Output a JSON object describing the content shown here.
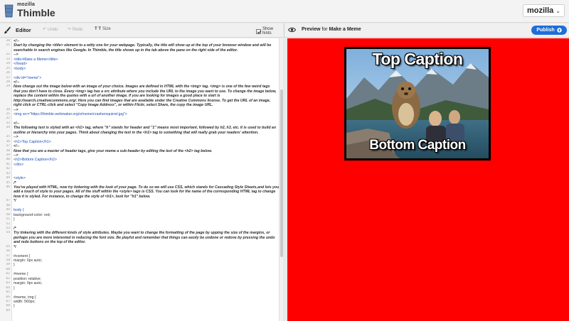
{
  "brand": {
    "mozilla": "mozilla",
    "name": "Thimble"
  },
  "account": {
    "label": "mozilla"
  },
  "editor_toolbar": {
    "title": "Editor",
    "undo": "Undo",
    "redo": "Redo",
    "size_glyph": "T T",
    "size": "Size",
    "hints": "Show hints"
  },
  "preview_toolbar": {
    "prefix": "Preview",
    "for": " for ",
    "page": "Make a Meme",
    "publish": "Publish"
  },
  "code_lines": [
    {
      "n": "20",
      "t": "<!--",
      "k": "comment"
    },
    {
      "n": "21",
      "t": "Start by changing the <title> element to a witty one for your webpage. Typically, the title will show up at the top of your browser window and will be",
      "k": "comment"
    },
    {
      "n": "",
      "t": "searchable in search engines like Google. In Thimble, the title shows up in the tab above the pane on the right side of the editor.",
      "k": "comment"
    },
    {
      "n": "22",
      "t": "-->",
      "k": "comment"
    },
    {
      "n": "23",
      "t": "    <title>Make a Meme</title>",
      "k": "tag"
    },
    {
      "n": "24",
      "t": "  </head>",
      "k": "tag"
    },
    {
      "n": "25",
      "t": "  <body>",
      "k": "tag"
    },
    {
      "n": "26",
      "t": "",
      "k": "tag"
    },
    {
      "n": "27",
      "t": "    <div id=\"meme\">",
      "k": "tag"
    },
    {
      "n": "28",
      "t": "<!--",
      "k": "comment"
    },
    {
      "n": "29",
      "t": "Now change out the image below with an image of your choice. Images are defined in HTML with the <img> tag. <img> is one of the few weird tags",
      "k": "comment"
    },
    {
      "n": "",
      "t": "that you don't have to close. Every <img> tag has a src attribute where you include the URL to the image you want to use. To change the image below,",
      "k": "comment"
    },
    {
      "n": "",
      "t": "replace the content within the quotes with a url of another image. If you are looking for images a good place to start is",
      "k": "comment"
    },
    {
      "n": "",
      "t": "http://search.creativecommons.org/. Here you can find images that are available under the Creative Commons license. To get the URL of an image,",
      "k": "comment"
    },
    {
      "n": "",
      "t": "right click or CTRL-click and select \"Copy Image Address\", or within Flickr, select Share, the copy the image URL.",
      "k": "comment"
    },
    {
      "n": "30",
      "t": "-->",
      "k": "comment"
    },
    {
      "n": "31",
      "t": "      <img src=\"https://thimble.webmaker.org/s/meme/crashersquirrel.jpg\">",
      "k": "tag"
    },
    {
      "n": "32",
      "t": "",
      "k": "tag"
    },
    {
      "n": "33",
      "t": "<!--",
      "k": "comment"
    },
    {
      "n": "34",
      "t": "The following text is styled with an <h1> tag, where \"h\" stands for header and \"1\" means most important, followed by h2, h3, etc. It is used to build an",
      "k": "comment"
    },
    {
      "n": "",
      "t": "outline or hierarchy into your pages. Think about changing the text in the <h1> tag to something that will really grab your readers' attention.",
      "k": "comment"
    },
    {
      "n": "35",
      "t": "-->",
      "k": "comment"
    },
    {
      "n": "36",
      "t": "      <h1>Top Caption</h1>",
      "k": "tag"
    },
    {
      "n": "37",
      "t": "<!--",
      "k": "comment"
    },
    {
      "n": "38",
      "t": "Now that you are a master of header tags, give your meme a sub-header by editing the text of the <h2> tag below.",
      "k": "comment"
    },
    {
      "n": "39",
      "t": "-->",
      "k": "comment"
    },
    {
      "n": "40",
      "t": "      <h2>Bottom Caption</h2>",
      "k": "tag"
    },
    {
      "n": "41",
      "t": "    </div>",
      "k": "tag"
    },
    {
      "n": "42",
      "t": "",
      "k": "tag"
    },
    {
      "n": "43",
      "t": "",
      "k": "tag"
    },
    {
      "n": "44",
      "t": "    <style>",
      "k": "tag"
    },
    {
      "n": "45",
      "t": "/*",
      "k": "comment"
    },
    {
      "n": "46",
      "t": "You've played with HTML, now try tinkering with the look of your page. To do so we will use CSS, which stands for Cascading Style Sheets,and lets you",
      "k": "comment"
    },
    {
      "n": "",
      "t": "add a touch of style to your pages. All of the stuff within the <style> tags is CSS. You can look for the name of the corresponding HTML tag to change",
      "k": "comment"
    },
    {
      "n": "",
      "t": "how it is styled. For instance, to change the style of <h1>, look for \"h1\" below.",
      "k": "comment"
    },
    {
      "n": "47",
      "t": "*/",
      "k": "comment"
    },
    {
      "n": "48",
      "t": "",
      "k": "css"
    },
    {
      "n": "49",
      "t": "      body {",
      "k": "tag"
    },
    {
      "n": "50",
      "t": "        background-color: red;",
      "k": "css"
    },
    {
      "n": "51",
      "t": "      }",
      "k": "css"
    },
    {
      "n": "52",
      "t": "",
      "k": "css"
    },
    {
      "n": "53",
      "t": "/*",
      "k": "comment"
    },
    {
      "n": "54",
      "t": "Try tinkering with the different kinds of style attributes. Maybe you want to change the formatting of the page by upping the size of the margins, or",
      "k": "comment"
    },
    {
      "n": "",
      "t": "perhaps you are more interested in reducing the font size. Be playful and remember that things can easily be undone or redone by pressing the undo",
      "k": "comment"
    },
    {
      "n": "",
      "t": "and redo buttons on the top of the editor.",
      "k": "comment"
    },
    {
      "n": "55",
      "t": "*/",
      "k": "comment"
    },
    {
      "n": "56",
      "t": "",
      "k": "css"
    },
    {
      "n": "57",
      "t": "      #content {",
      "k": "css"
    },
    {
      "n": "58",
      "t": "        margin: 0px auto;",
      "k": "css"
    },
    {
      "n": "59",
      "t": "      }",
      "k": "css"
    },
    {
      "n": "60",
      "t": "",
      "k": "css"
    },
    {
      "n": "61",
      "t": "      #meme {",
      "k": "css"
    },
    {
      "n": "62",
      "t": "        position: relative;",
      "k": "css"
    },
    {
      "n": "63",
      "t": "        margin: 0px auto;",
      "k": "css"
    },
    {
      "n": "64",
      "t": "      }",
      "k": "css"
    },
    {
      "n": "65",
      "t": "",
      "k": "css"
    },
    {
      "n": "66",
      "t": "      #meme, img {",
      "k": "css"
    },
    {
      "n": "67",
      "t": "        width: 560px;",
      "k": "css"
    },
    {
      "n": "68",
      "t": "      }",
      "k": "css"
    },
    {
      "n": "69",
      "t": "",
      "k": "css"
    }
  ],
  "meme": {
    "top_caption": "Top Caption",
    "bottom_caption": "Bottom Caption"
  },
  "colors": {
    "preview_bg": "#ff0000",
    "publish_bg": "#1e6ed8"
  },
  "icons": {
    "logo": "thimble-logo-icon",
    "brush": "brush-icon",
    "eye": "eye-icon",
    "undo": "undo-icon",
    "redo": "redo-icon",
    "publish": "upload-icon",
    "chevron": "chevron-down-icon"
  }
}
